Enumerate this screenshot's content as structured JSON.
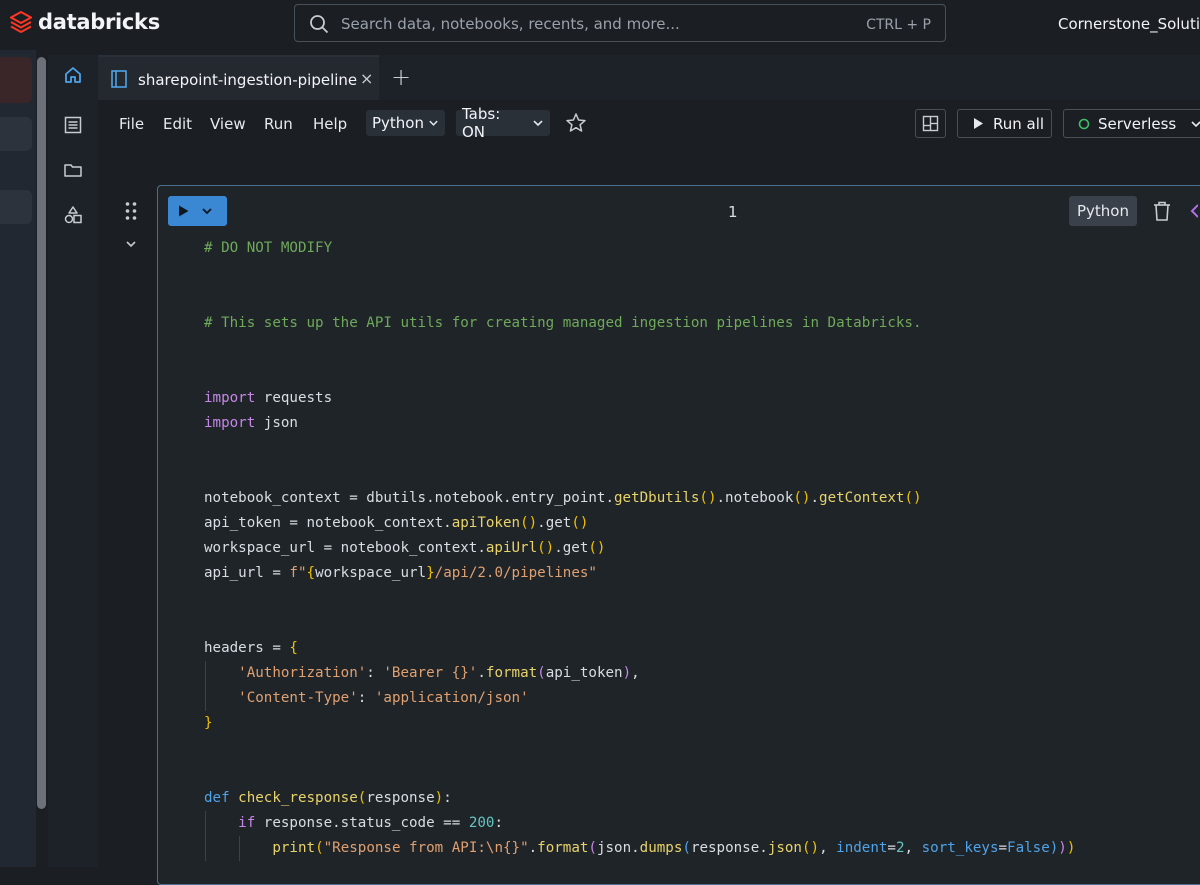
{
  "brand": {
    "name": "databricks"
  },
  "search": {
    "placeholder": "Search data, notebooks, recents, and more...",
    "shortcut": "CTRL + P"
  },
  "workspace": {
    "name": "Cornerstone_Solutio"
  },
  "tabs": [
    {
      "label": "sharepoint-ingestion-pipeline",
      "close": "×"
    }
  ],
  "new_tab": "+",
  "menu": [
    "File",
    "Edit",
    "View",
    "Run",
    "Help"
  ],
  "language_dropdown": "Python",
  "tabs_toggle": "Tabs: ON",
  "toolbar": {
    "run_all": "Run all",
    "compute": "Serverless"
  },
  "cell": {
    "number": "1",
    "language": "Python",
    "lines": [
      [
        {
          "t": "# DO NOT MODIFY",
          "c": "comment"
        }
      ],
      [],
      [],
      [
        {
          "t": "# This sets up the API utils for creating managed ingestion pipelines in Databricks.",
          "c": "comment"
        }
      ],
      [],
      [],
      [
        {
          "t": "import",
          "c": "kw"
        },
        {
          "t": " requests",
          "c": "op"
        }
      ],
      [
        {
          "t": "import",
          "c": "kw"
        },
        {
          "t": " json",
          "c": "op"
        }
      ],
      [],
      [],
      [
        {
          "t": "notebook_context = dbutils.notebook.entry_point.",
          "c": "op"
        },
        {
          "t": "getDbutils",
          "c": "fn"
        },
        {
          "t": "()",
          "c": "paren"
        },
        {
          "t": ".notebook",
          "c": "op"
        },
        {
          "t": "()",
          "c": "paren"
        },
        {
          "t": ".",
          "c": "op"
        },
        {
          "t": "getContext",
          "c": "fn"
        },
        {
          "t": "()",
          "c": "paren"
        }
      ],
      [
        {
          "t": "api_token = notebook_context.",
          "c": "op"
        },
        {
          "t": "apiToken",
          "c": "fn"
        },
        {
          "t": "()",
          "c": "paren"
        },
        {
          "t": ".get",
          "c": "op"
        },
        {
          "t": "()",
          "c": "paren"
        }
      ],
      [
        {
          "t": "workspace_url = notebook_context.",
          "c": "op"
        },
        {
          "t": "apiUrl",
          "c": "fn"
        },
        {
          "t": "()",
          "c": "paren"
        },
        {
          "t": ".get",
          "c": "op"
        },
        {
          "t": "()",
          "c": "paren"
        }
      ],
      [
        {
          "t": "api_url = ",
          "c": "op"
        },
        {
          "t": "f\"",
          "c": "str"
        },
        {
          "t": "{",
          "c": "paren"
        },
        {
          "t": "workspace_url",
          "c": "op"
        },
        {
          "t": "}",
          "c": "paren"
        },
        {
          "t": "/api/2.0/pipelines\"",
          "c": "str"
        }
      ],
      [],
      [],
      [
        {
          "t": "headers = ",
          "c": "op"
        },
        {
          "t": "{",
          "c": "paren"
        }
      ],
      [
        {
          "t": "    ",
          "c": "op",
          "g": [
            1
          ]
        },
        {
          "t": "'Authorization'",
          "c": "str"
        },
        {
          "t": ": ",
          "c": "op"
        },
        {
          "t": "'Bearer {}'",
          "c": "str"
        },
        {
          "t": ".",
          "c": "op"
        },
        {
          "t": "format",
          "c": "fn"
        },
        {
          "t": "(",
          "c": "kw"
        },
        {
          "t": "api_token",
          "c": "op"
        },
        {
          "t": ")",
          "c": "kw"
        },
        {
          "t": ",",
          "c": "op"
        }
      ],
      [
        {
          "t": "    ",
          "c": "op",
          "g": [
            1
          ]
        },
        {
          "t": "'Content-Type'",
          "c": "str"
        },
        {
          "t": ": ",
          "c": "op"
        },
        {
          "t": "'application/json'",
          "c": "str"
        }
      ],
      [
        {
          "t": "}",
          "c": "paren"
        }
      ],
      [],
      [],
      [
        {
          "t": "def",
          "c": "kw2"
        },
        {
          "t": " ",
          "c": "op"
        },
        {
          "t": "check_response",
          "c": "fn"
        },
        {
          "t": "(",
          "c": "paren"
        },
        {
          "t": "response",
          "c": "op"
        },
        {
          "t": ")",
          "c": "paren"
        },
        {
          "t": ":",
          "c": "op"
        }
      ],
      [
        {
          "t": "    ",
          "c": "op",
          "g": [
            1
          ]
        },
        {
          "t": "if",
          "c": "kw"
        },
        {
          "t": " response.status_code == ",
          "c": "op"
        },
        {
          "t": "200",
          "c": "cls"
        },
        {
          "t": ":",
          "c": "op"
        }
      ],
      [
        {
          "t": "        ",
          "c": "op",
          "g": [
            1,
            2
          ]
        },
        {
          "t": "print",
          "c": "fn"
        },
        {
          "t": "(",
          "c": "paren"
        },
        {
          "t": "\"Response from API:\\n{}\"",
          "c": "str"
        },
        {
          "t": ".",
          "c": "op"
        },
        {
          "t": "format",
          "c": "fn"
        },
        {
          "t": "(",
          "c": "kw"
        },
        {
          "t": "json.",
          "c": "op"
        },
        {
          "t": "dumps",
          "c": "fn"
        },
        {
          "t": "(",
          "c": "kw2"
        },
        {
          "t": "response.",
          "c": "op"
        },
        {
          "t": "json",
          "c": "fn"
        },
        {
          "t": "()",
          "c": "paren"
        },
        {
          "t": ", ",
          "c": "op"
        },
        {
          "t": "indent",
          "c": "kw2"
        },
        {
          "t": "=",
          "c": "op"
        },
        {
          "t": "2",
          "c": "cls"
        },
        {
          "t": ", ",
          "c": "op"
        },
        {
          "t": "sort_keys",
          "c": "kw2"
        },
        {
          "t": "=",
          "c": "op"
        },
        {
          "t": "False",
          "c": "kw2"
        },
        {
          "t": ")",
          "c": "kw2"
        },
        {
          "t": ")",
          "c": "kw"
        },
        {
          "t": ")",
          "c": "paren"
        }
      ]
    ]
  }
}
